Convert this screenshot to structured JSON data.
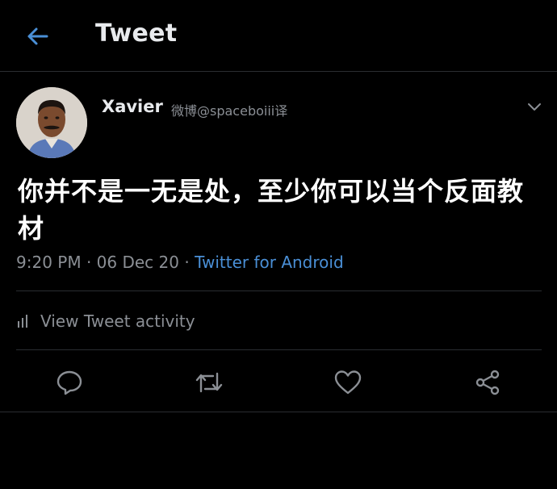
{
  "header": {
    "title": "Tweet",
    "back_icon": "arrow-left-icon",
    "accent": "#4a8fd6"
  },
  "tweet": {
    "author_name": "Xavier",
    "author_handle": "微博@spaceboiii译",
    "text": "你并不是一无是处，至少你可以当个反面教材",
    "time": "9:20 PM",
    "date": "06 Dec 20",
    "source": "Twitter for Android",
    "separator": " · "
  },
  "activity": {
    "label": "View Tweet activity",
    "icon": "bar-chart-icon"
  },
  "actions": [
    {
      "name": "reply",
      "icon": "reply-icon"
    },
    {
      "name": "retweet",
      "icon": "retweet-icon"
    },
    {
      "name": "like",
      "icon": "heart-icon"
    },
    {
      "name": "share",
      "icon": "share-icon"
    }
  ],
  "colors": {
    "background": "#000000",
    "text_primary": "#ffffff",
    "text_secondary": "#8b8f95",
    "link": "#4a8fd6",
    "divider": "#2a2d31"
  }
}
